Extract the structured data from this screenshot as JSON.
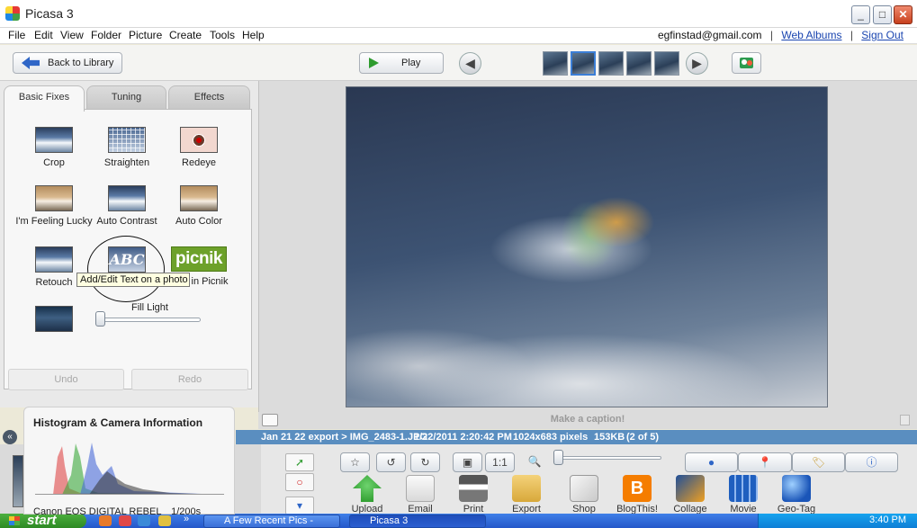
{
  "window": {
    "title": "Picasa 3"
  },
  "menu": [
    "File",
    "Edit",
    "View",
    "Folder",
    "Picture",
    "Create",
    "Tools",
    "Help"
  ],
  "account": {
    "email": "egfinstad@gmail.com",
    "web_albums": "Web Albums",
    "sign_out": "Sign Out",
    "separator": "|"
  },
  "toolbar": {
    "back_label": "Back to Library",
    "play_label": "Play",
    "filmstrip_count": 5,
    "filmstrip_selected": 2
  },
  "tabs": [
    "Basic Fixes",
    "Tuning",
    "Effects"
  ],
  "fixes": {
    "crop": "Crop",
    "straighten": "Straighten",
    "redeye": "Redeye",
    "lucky": "I'm Feeling Lucky",
    "auto_contrast": "Auto Contrast",
    "auto_color": "Auto Color",
    "retouch": "Retouch",
    "text_icon": "ABC",
    "picnik_logo": "picnik",
    "picnik_label": "in Picnik",
    "tooltip": "Add/Edit Text on a photo",
    "fill_light": "Fill Light",
    "fill_light_value": 0,
    "undo": "Undo",
    "redo": "Redo"
  },
  "caption": {
    "placeholder": "Make a caption!"
  },
  "status": {
    "path": "Jan 21 22 export > IMG_2483-1.JPG",
    "datetime": "1/22/2011 2:20:42 PM",
    "dimensions": "1024x683 pixels",
    "size": "153KB",
    "position": "(2 of 5)"
  },
  "histogram": {
    "title": "Histogram & Camera Information",
    "camera": "Canon EOS DIGITAL REBEL",
    "exposure": "1/200s",
    "colors": {
      "red": "#e04848",
      "green": "#3aa83a",
      "blue": "#4a6ad8",
      "luma": "#333333"
    }
  },
  "tray": {
    "one_to_one": "1:1",
    "zoom_value": 0
  },
  "actions": [
    "Upload",
    "Email",
    "Print",
    "Export",
    "Shop",
    "BlogThis!",
    "Collage",
    "Movie",
    "Geo-Tag"
  ],
  "blogger_letter": "B",
  "taskbar": {
    "start": "start",
    "tasks": [
      "A Few Recent Pics -",
      "Picasa 3"
    ],
    "overflow": "»",
    "clock": "3:40 PM"
  },
  "colors": {
    "statusbar": "#5a8ec0",
    "accent": "#3b7ed6",
    "taskbar": "#2457c9"
  }
}
